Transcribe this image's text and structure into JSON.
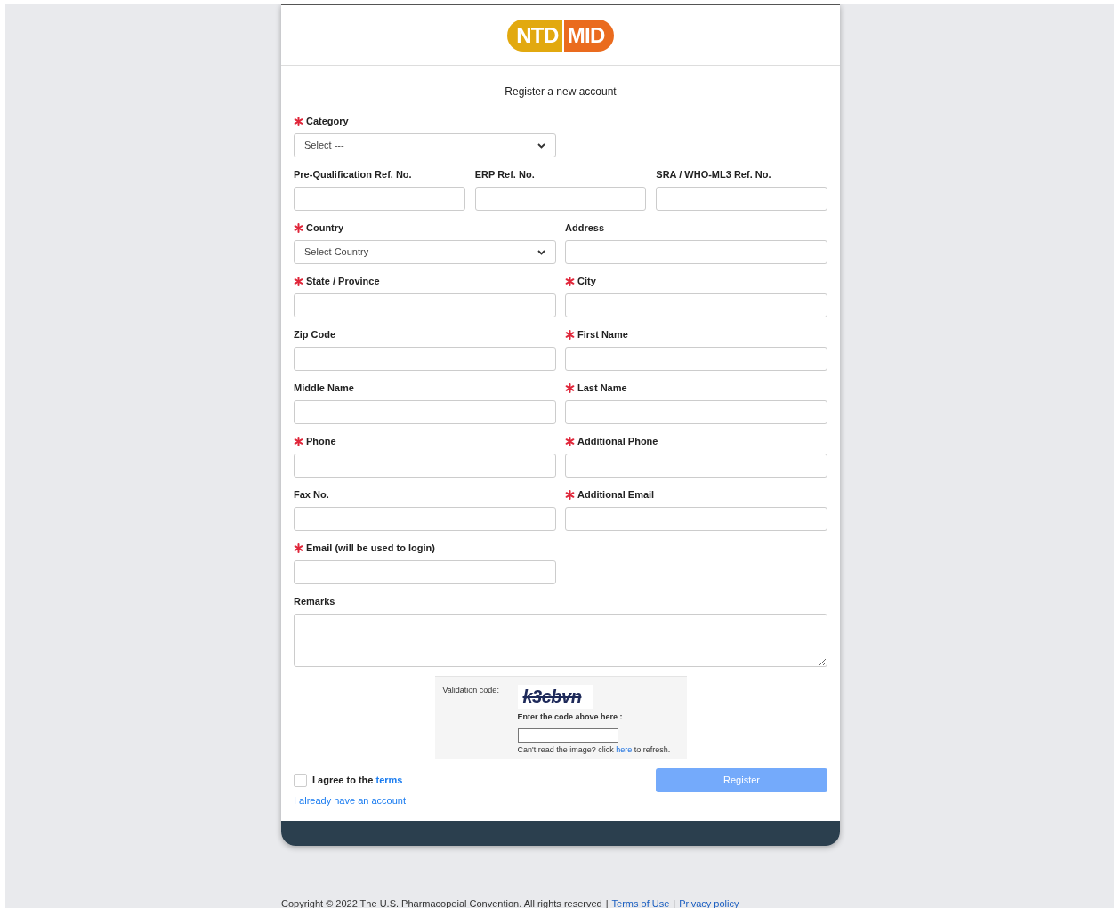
{
  "logo": {
    "left": "NTD",
    "right": "MID"
  },
  "heading": "Register a new account",
  "rows": [
    {
      "fields": [
        {
          "label": "Category",
          "required": true,
          "kind": "select",
          "value": "Select ---"
        }
      ]
    },
    {
      "fields": [
        {
          "label": "Pre-Qualification Ref. No.",
          "required": false,
          "kind": "input"
        },
        {
          "label": "ERP Ref. No.",
          "required": false,
          "kind": "input"
        },
        {
          "label": "SRA / WHO-ML3 Ref. No.",
          "required": false,
          "kind": "input"
        }
      ]
    },
    {
      "fields": [
        {
          "label": "Country",
          "required": true,
          "kind": "select",
          "value": "Select Country"
        },
        {
          "label": "Address",
          "required": false,
          "kind": "input"
        }
      ]
    },
    {
      "fields": [
        {
          "label": "State / Province",
          "required": true,
          "kind": "input"
        },
        {
          "label": "City",
          "required": true,
          "kind": "input"
        }
      ]
    },
    {
      "fields": [
        {
          "label": "Zip Code",
          "required": false,
          "kind": "input"
        },
        {
          "label": "First Name",
          "required": true,
          "kind": "input"
        }
      ]
    },
    {
      "fields": [
        {
          "label": "Middle Name",
          "required": false,
          "kind": "input"
        },
        {
          "label": "Last Name",
          "required": true,
          "kind": "input"
        }
      ]
    },
    {
      "fields": [
        {
          "label": "Phone",
          "required": true,
          "kind": "input"
        },
        {
          "label": "Additional Phone",
          "required": true,
          "kind": "input"
        }
      ]
    },
    {
      "fields": [
        {
          "label": "Fax No.",
          "required": false,
          "kind": "input"
        },
        {
          "label": "Additional Email",
          "required": true,
          "kind": "input"
        }
      ]
    },
    {
      "fields": [
        {
          "label": "Email (will be used to login)",
          "required": true,
          "kind": "input"
        }
      ]
    },
    {
      "fields": [
        {
          "label": "Remarks",
          "required": false,
          "kind": "textarea"
        }
      ]
    }
  ],
  "captcha": {
    "label": "Validation code:",
    "code": "k3cbvn",
    "prompt": "Enter the code above here :",
    "refresh_before": "Can't read the image? click",
    "refresh_link": "here",
    "refresh_after": "to refresh."
  },
  "agree": {
    "checked": false,
    "text": "I agree to the",
    "link": "terms"
  },
  "register_button": {
    "label": "Register",
    "disabled": true
  },
  "login_link": "I already have an account",
  "footer": {
    "copyright": "Copyright © 2022 The U.S. Pharmacopeial Convention. All rights reserved",
    "separator_1": "|",
    "terms_link": "Terms of Use",
    "separator_2": "|",
    "privacy_link": "Privacy policy"
  }
}
